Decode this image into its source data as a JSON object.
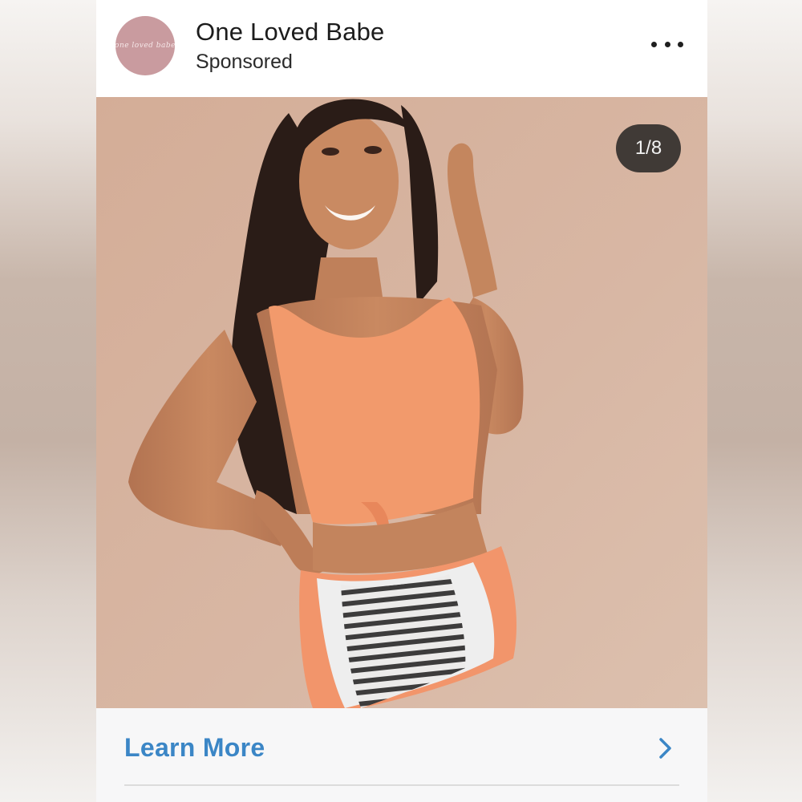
{
  "post": {
    "brand_name": "One Loved Babe",
    "sponsored_label": "Sponsored",
    "avatar_text": "one loved babe",
    "more_icon": "more-horizontal-icon"
  },
  "media": {
    "counter": "1/8",
    "image_description_icon": "photo"
  },
  "cta": {
    "label": "Learn More",
    "chevron_icon": "chevron-right-icon"
  },
  "colors": {
    "cta_text": "#3b86c6",
    "avatar_bg": "#c99b9f",
    "photo_bg": "#d6b5a2",
    "top_orange": "#f29a6c"
  }
}
